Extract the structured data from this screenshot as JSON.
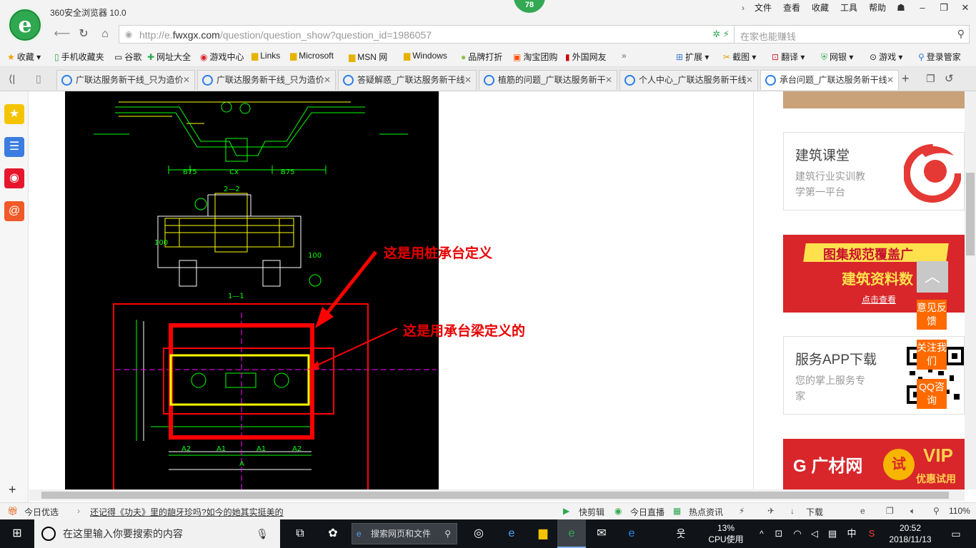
{
  "window": {
    "title": "360安全浏览器 10.0",
    "badge": "78"
  },
  "menu": [
    "文件",
    "查看",
    "收藏",
    "工具",
    "帮助"
  ],
  "address": {
    "url_prefix": "http://e.",
    "url_domain": "fwxgx.com",
    "url_path": "/question/question_show?question_id=1986057",
    "search_placeholder": "在家也能赚钱"
  },
  "favorites": [
    "收藏",
    "手机收藏夹",
    "谷歌",
    "网址大全",
    "游戏中心",
    "Links",
    "Microsoft",
    "MSN 网",
    "Windows",
    "品牌打折",
    "淘宝团购",
    "外国网友"
  ],
  "toolbar_right": [
    "扩展",
    "截图",
    "翻译",
    "网银",
    "游戏",
    "登录管家"
  ],
  "tabs": [
    {
      "label": "广联达服务新干线_只为造价"
    },
    {
      "label": "广联达服务新干线_只为造价"
    },
    {
      "label": "答疑解惑_广联达服务新干线"
    },
    {
      "label": "植筋的问题_广联达服务新干"
    },
    {
      "label": "个人中心_广联达服务新干线"
    },
    {
      "label": "承台问题_广联达服务新干线"
    }
  ],
  "annotations": {
    "pile_cap": "这是用桩承台定义",
    "cap_beam": "这是用承台梁定义的"
  },
  "sidebar_right": {
    "course_title": "建筑课堂",
    "course_sub1": "建筑行业实训教",
    "course_sub2": "学第一平台",
    "banner_text1": "图集规范覆盖广",
    "banner_text2": "建筑资料数",
    "banner_link": "点击查看",
    "app_title": "服务APP下载",
    "app_sub1": "您的掌上服务专",
    "app_sub2": "家",
    "ad_brand": "广材网",
    "ad_vip": "VIP",
    "ad_try": "试",
    "ad_sub": "优惠试用"
  },
  "float_buttons": [
    "意见反馈",
    "关注我们",
    "QQ咨询"
  ],
  "status": {
    "news_label": "今日优选",
    "headline": "还记得《功夫》里的龅牙珍吗?如今的她其实挺美的",
    "items": [
      "快剪辑",
      "今日直播",
      "热点资讯",
      "下载"
    ],
    "zoom": "110%"
  },
  "taskbar": {
    "search_placeholder": "在这里输入你要搜索的内容",
    "web_search": "搜索网页和文件",
    "cpu_percent": "13%",
    "cpu_label": "CPU使用",
    "ime": "中",
    "time": "20:52",
    "date": "2018/11/13"
  }
}
